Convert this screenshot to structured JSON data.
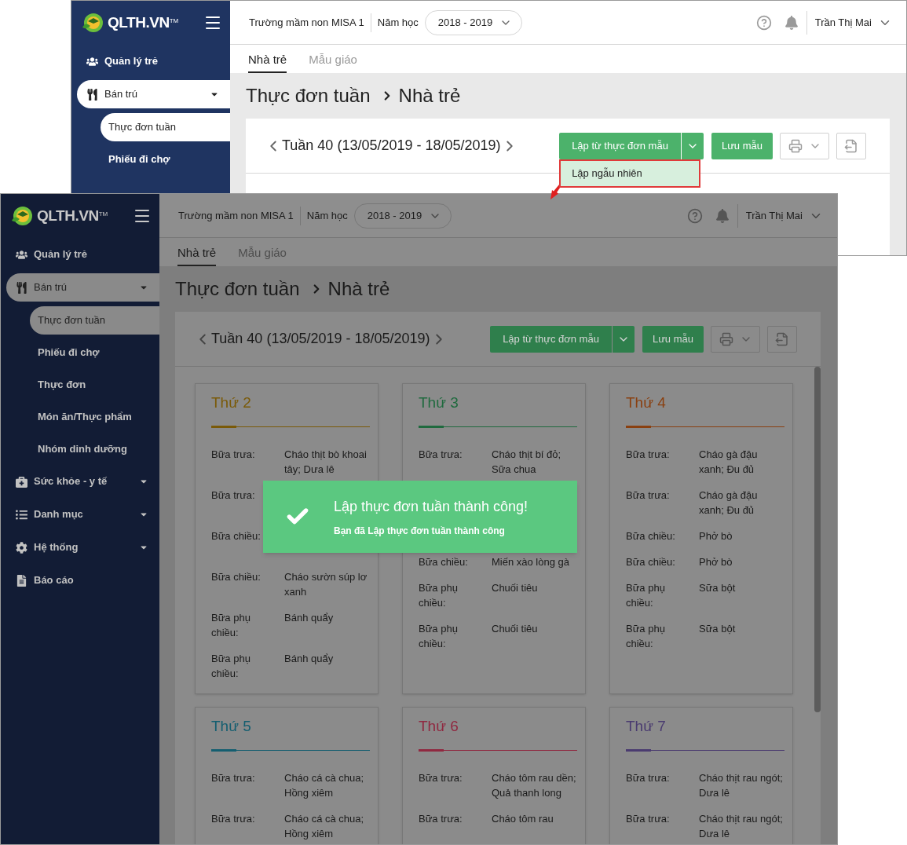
{
  "back_screenshot": {
    "dimmed": false,
    "logo": {
      "text": "QLTH.VN",
      "mark": "TM"
    },
    "sidebar": [
      {
        "label": "Quản lý trẻ",
        "selected": false,
        "expandable": false
      },
      {
        "label": "Bán trú",
        "selected": true,
        "expandable": true,
        "children": [
          {
            "label": "Thực đơn tuần",
            "selected": true
          },
          {
            "label": "Phiếu đi chợ",
            "selected": false
          }
        ]
      }
    ],
    "header": {
      "school": "Trường mầm non MISA 1",
      "year_label": "Năm học",
      "year": "2018 - 2019",
      "user": "Trần Thị Mai"
    },
    "tabs": [
      {
        "label": "Nhà trẻ",
        "selected": true
      },
      {
        "label": "Mẫu giáo",
        "selected": false
      }
    ],
    "title": "Thực đơn tuần",
    "breadcrumb": "Nhà trẻ",
    "week": "Tuần 40 (13/05/2019 - 18/05/2019)",
    "buttons": {
      "template": "Lập từ thực đơn mẫu",
      "save": "Lưu mẫu"
    },
    "dropdown": [
      {
        "label": "Lập ngẫu nhiên",
        "selected": true
      }
    ]
  },
  "front_screenshot": {
    "dimmed": true,
    "logo": {
      "text": "QLTH.VN",
      "mark": "TM"
    },
    "sidebar": [
      {
        "label": "Quản lý trẻ",
        "selected": false,
        "expandable": false
      },
      {
        "label": "Bán trú",
        "selected": true,
        "expandable": true,
        "children": [
          {
            "label": "Thực đơn tuần",
            "selected": true
          },
          {
            "label": "Phiếu đi chợ",
            "selected": false
          },
          {
            "label": "Thực đơn",
            "selected": false
          },
          {
            "label": "Món ăn/Thực phẩm",
            "selected": false
          },
          {
            "label": "Nhóm dinh dưỡng",
            "selected": false
          }
        ]
      },
      {
        "label": "Sức khỏe - y tế",
        "selected": false,
        "expandable": true
      },
      {
        "label": "Danh mục",
        "selected": false,
        "expandable": true
      },
      {
        "label": "Hệ thống",
        "selected": false,
        "expandable": true
      },
      {
        "label": "Báo cáo",
        "selected": false,
        "expandable": false
      }
    ],
    "header": {
      "school": "Trường mầm non MISA 1",
      "year_label": "Năm học",
      "year": "2018 - 2019",
      "user": "Trần Thị Mai"
    },
    "tabs": [
      {
        "label": "Nhà trẻ",
        "selected": true
      },
      {
        "label": "Mẫu giáo",
        "selected": false
      }
    ],
    "title": "Thực đơn tuần",
    "breadcrumb": "Nhà trẻ",
    "week": "Tuần 40 (13/05/2019 - 18/05/2019)",
    "buttons": {
      "template": "Lập từ thực đơn mẫu",
      "save": "Lưu mẫu"
    },
    "days": [
      {
        "name": "Thứ 2",
        "color": "#7a5a08",
        "meals": [
          {
            "kind": "meal",
            "label": "Bữa trưa:",
            "dish": "Cháo thịt bò khoai tây; Dưa lê"
          },
          {
            "kind": "dish_covered",
            "label": "Bữa trưa:"
          },
          {
            "kind": "dish_covered",
            "label": "Bữa chiều:"
          },
          {
            "kind": "meal",
            "label": "Bữa chiều:",
            "dish": "Cháo sườn súp lơ xanh"
          },
          {
            "kind": "meal",
            "label": "Bữa phụ chiều:",
            "dish": "Bánh quẩy"
          },
          {
            "kind": "meal",
            "label": "Bữa phụ chiều:",
            "dish": "Bánh quẩy"
          }
        ]
      },
      {
        "name": "Thứ 3",
        "color": "#1f6a3e",
        "meals": [
          {
            "kind": "meal",
            "label": "Bữa trưa:",
            "dish": "Cháo thịt bí đỏ; Sữa chua"
          },
          {
            "kind": "covered"
          },
          {
            "kind": "covered_short"
          },
          {
            "kind": "meal",
            "label": "Bữa chiều:",
            "dish": "Miến xào lòng gà"
          },
          {
            "kind": "meal",
            "label": "Bữa phụ chiều:",
            "dish": "Chuối tiêu"
          },
          {
            "kind": "meal",
            "label": "Bữa phụ chiều:",
            "dish": "Chuối tiêu"
          }
        ]
      },
      {
        "name": "Thứ 4",
        "color": "#8a4010",
        "meals": [
          {
            "kind": "meal",
            "label": "Bữa trưa:",
            "dish": "Cháo gà đậu xanh; Đu đủ"
          },
          {
            "kind": "meal",
            "label": "Bữa trưa:",
            "dish": "Cháo gà đậu xanh; Đu đủ"
          },
          {
            "kind": "meal",
            "label": "Bữa chiều:",
            "dish": "Phở bò"
          },
          {
            "kind": "meal",
            "label": "Bữa chiều:",
            "dish": "Phở bò"
          },
          {
            "kind": "meal",
            "label": "Bữa phụ chiều:",
            "dish": "Sữa bột"
          },
          {
            "kind": "meal",
            "label": "Bữa phụ chiều:",
            "dish": "Sữa bột"
          }
        ]
      },
      {
        "name": "Thứ 5",
        "color": "#145e70",
        "meals": [
          {
            "kind": "meal",
            "label": "Bữa trưa:",
            "dish": "Cháo cá cà chua; Hồng xiêm"
          },
          {
            "kind": "meal",
            "label": "Bữa trưa:",
            "dish": "Cháo cá cà chua; Hồng xiêm"
          }
        ]
      },
      {
        "name": "Thứ 6",
        "color": "#902840",
        "meals": [
          {
            "kind": "meal",
            "label": "Bữa trưa:",
            "dish": "Cháo tôm rau dền; Quả thanh long"
          },
          {
            "kind": "meal",
            "label": "Bữa trưa:",
            "dish": "Cháo tôm rau"
          }
        ]
      },
      {
        "name": "Thứ 7",
        "color": "#4a3b70",
        "meals": [
          {
            "kind": "meal",
            "label": "Bữa trưa:",
            "dish": "Cháo thịt rau ngót; Dưa lê"
          },
          {
            "kind": "meal",
            "label": "Bữa trưa:",
            "dish": "Cháo thịt rau ngót; Dưa lê"
          }
        ]
      }
    ],
    "toast": {
      "title": "Lập thực đơn tuần thành công!",
      "message": "Bạn đã Lập thực đơn tuần thành công"
    }
  }
}
